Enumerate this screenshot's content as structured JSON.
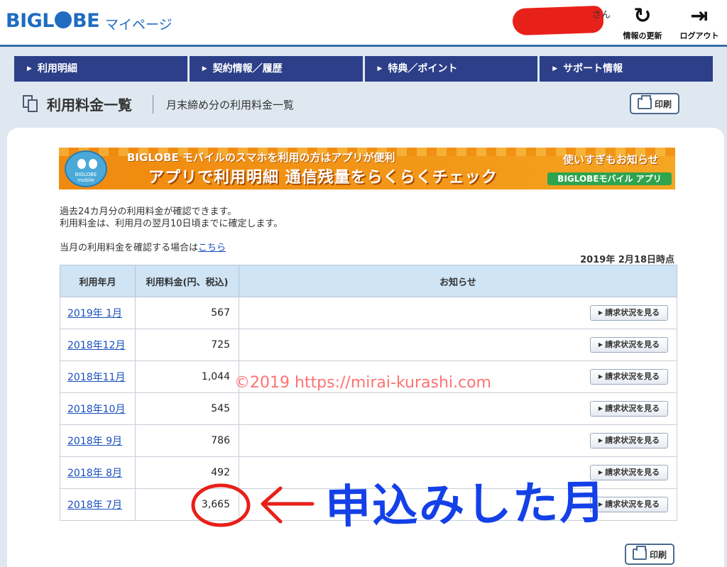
{
  "header": {
    "logo": "BIGL",
    "logo_rest": "BE",
    "logo_sub": "マイページ",
    "user_suffix": "さん",
    "refresh_label": "情報の更新",
    "logout_label": "ログアウト",
    "refresh_icon": "refresh-icon",
    "logout_icon": "logout-icon"
  },
  "nav": {
    "items": [
      "利用明細",
      "契約情報／履歴",
      "特典／ポイント",
      "サポート情報"
    ]
  },
  "title_bar": {
    "title": "利用料金一覧",
    "subtitle": "月末締め分の利用料金一覧",
    "print_label": "印刷"
  },
  "banner": {
    "mascot_text": "BIGLOBE mobile",
    "line1": "BIGLOBE モバイルのスマホを利用の方はアプリが便利",
    "line2": "アプリで利用明細 通信残量をらくらくチェック",
    "right1": "使いすぎもお知らせ",
    "right2": "BIGLOBEモバイル アプリ"
  },
  "info": {
    "line1": "過去24カ月分の利用料金が確認できます。",
    "line2": "利用料金は、利用月の翌月10日頃までに確定します。",
    "current_prefix": "当月の利用料金を確認する場合は",
    "current_link": "こちら",
    "as_of": "2019年 2月18日時点"
  },
  "table": {
    "headers": [
      "利用年月",
      "利用料金(円、税込)",
      "お知らせ"
    ],
    "detail_label": "請求状況を見る",
    "rows": [
      {
        "month": "2019年 1月",
        "amount": "567"
      },
      {
        "month": "2018年12月",
        "amount": "725"
      },
      {
        "month": "2018年11月",
        "amount": "1,044"
      },
      {
        "month": "2018年10月",
        "amount": "545"
      },
      {
        "month": "2018年 9月",
        "amount": "786"
      },
      {
        "month": "2018年 8月",
        "amount": "492"
      },
      {
        "month": "2018年 7月",
        "amount": "3,665"
      }
    ]
  },
  "annotations": {
    "watermark": "©2019 https://mirai-kurashi.com",
    "handwriting": "申込みした月"
  },
  "colors": {
    "nav_bg": "#2c3f88",
    "brand_blue": "#1f6cc1",
    "annotation_red": "#e8201a",
    "annotation_blue": "#1440e8"
  }
}
